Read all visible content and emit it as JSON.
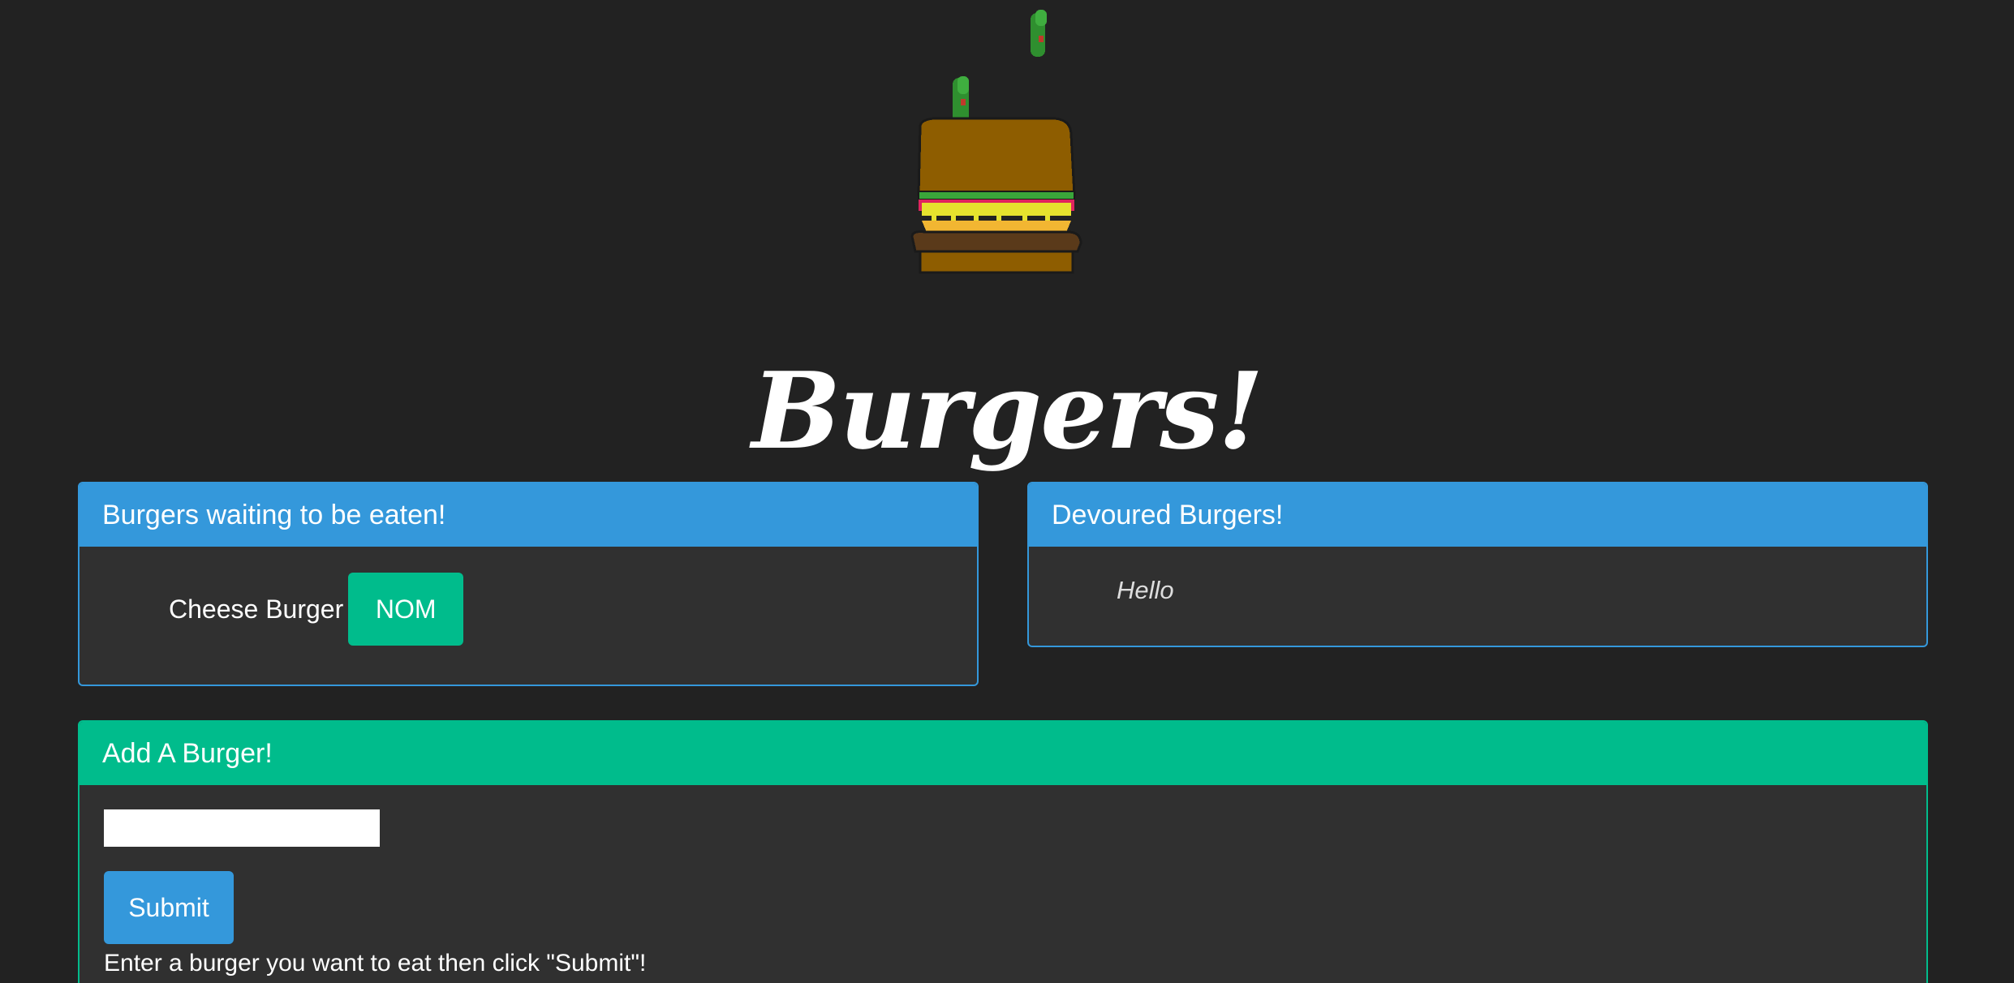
{
  "header": {
    "logo_icon": "pixel-burger-with-pickles-icon",
    "title": "Burgers!"
  },
  "waiting_panel": {
    "heading": "Burgers waiting to be eaten!",
    "items": [
      {
        "name": "Cheese Burger",
        "button_label": "NOM"
      }
    ]
  },
  "devoured_panel": {
    "heading": "Devoured Burgers!",
    "items": [
      {
        "name": "Hello"
      }
    ]
  },
  "add_panel": {
    "heading": "Add A Burger!",
    "input_value": "",
    "submit_label": "Submit",
    "help_text": "Enter a burger you want to eat then click \"Submit\"!"
  },
  "colors": {
    "background": "#222222",
    "panel_body": "#303030",
    "primary_blue": "#3498db",
    "success_green": "#00bc8c",
    "text": "#ffffff"
  }
}
